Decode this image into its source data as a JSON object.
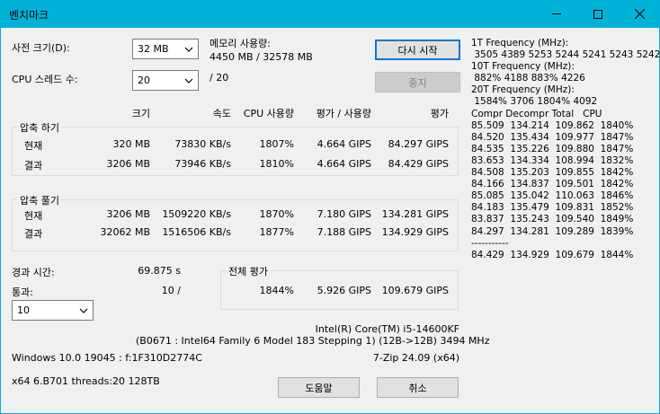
{
  "window": {
    "title": "벤치마크"
  },
  "controls": {
    "dict_label": "사전 크기(D):",
    "dict_value": "32 MB",
    "mem_label": "메모리 사용량:",
    "mem_value": "4450 MB / 32578 MB",
    "threads_label": "CPU 스레드 수:",
    "threads_value": "20",
    "threads_total": "/ 20",
    "restart_label": "다시 시작",
    "stop_label": "중지"
  },
  "headers": {
    "size": "크기",
    "speed": "속도",
    "cpu": "CPU 사용량",
    "rating_usage": "평가 / 사용량",
    "rating": "평가"
  },
  "compress": {
    "title": "압축 하기",
    "rows": [
      {
        "label": "현재",
        "size": "320 MB",
        "speed": "73830 KB/s",
        "cpu": "1807%",
        "ru": "4.664 GIPS",
        "rating": "84.297 GIPS"
      },
      {
        "label": "결과",
        "size": "3206 MB",
        "speed": "73946 KB/s",
        "cpu": "1810%",
        "ru": "4.664 GIPS",
        "rating": "84.429 GIPS"
      }
    ]
  },
  "decompress": {
    "title": "압축 풀기",
    "rows": [
      {
        "label": "현재",
        "size": "3206 MB",
        "speed": "1509220 KB/s",
        "cpu": "1870%",
        "ru": "7.180 GIPS",
        "rating": "134.281 GIPS"
      },
      {
        "label": "결과",
        "size": "32062 MB",
        "speed": "1516506 KB/s",
        "cpu": "1877%",
        "ru": "7.188 GIPS",
        "rating": "134.929 GIPS"
      }
    ]
  },
  "elapsed": {
    "label": "경과 시간:",
    "value": "69.875 s"
  },
  "passes": {
    "label": "통과:",
    "value": "10 /",
    "select_value": "10"
  },
  "total": {
    "title": "전체 평가",
    "cpu": "1844%",
    "ru": "5.926 GIPS",
    "rating": "109.679 GIPS"
  },
  "sysinfo": {
    "cpu_name": "Intel(R) Core(TM) i5-14600KF",
    "cpu_detail": "(B0671 : Intel64 Family 6 Model 183 Stepping 1) (12B->12B) 3494 MHz",
    "os": "Windows 10.0 19045 : f:1F310D2774C",
    "zip_version": "7-Zip 24.09 (x64)",
    "build": "x64 6.B701 threads:20 128TB"
  },
  "buttons": {
    "help": "도움말",
    "cancel": "취소"
  },
  "freq_log": [
    "1T Frequency (MHz):",
    " 3505 4389 5253 5244 5241 5243 5242",
    "10T Frequency (MHz):",
    " 882% 4188 883% 4226",
    "20T Frequency (MHz):",
    " 1584% 3706 1804% 4092",
    "Compr Decompr Total   CPU",
    "85.509  134.214  109.862  1840%",
    "84.520  135.434  109.977  1847%",
    "84.535  135.226  109.880  1847%",
    "83.653  134.334  108.994  1832%",
    "84.508  135.203  109.855  1842%",
    "84.166  134.837  109.501  1842%",
    "85.085  135.042  110.063  1846%",
    "84.183  135.479  109.831  1852%",
    "83.837  135.243  109.540  1849%",
    "84.297  134.281  109.289  1839%",
    "-----------",
    "84.429  134.929  109.679  1844%"
  ]
}
